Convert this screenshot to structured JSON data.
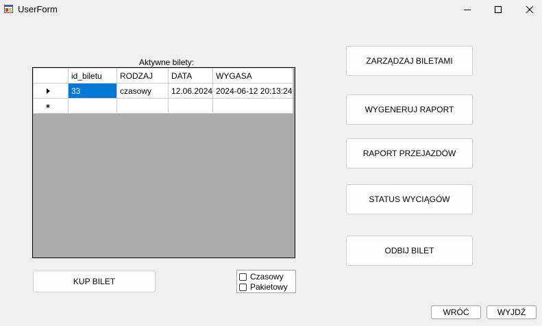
{
  "window": {
    "title": "UserForm",
    "minimize_icon": "minimize-icon",
    "maximize_icon": "maximize-icon",
    "close_icon": "close-icon"
  },
  "grid_caption": "Aktywne bilety:",
  "grid": {
    "columns": [
      "id_biletu",
      "RODZAJ",
      "DATA",
      "WYGASA"
    ],
    "rows": [
      {
        "indicator": "current-row-arrow-icon",
        "cells": [
          "33",
          "czasowy",
          "12.06.2024",
          "2024-06-12 20:13:24"
        ]
      },
      {
        "indicator": "new-row-asterisk-icon",
        "cells": [
          "",
          "",
          "",
          ""
        ]
      }
    ],
    "selected_cell": "33"
  },
  "buttons": {
    "manage_tickets": "ZARZĄDZAJ BILETAMI",
    "generate_report": "WYGENERUJ RAPORT",
    "rides_report": "RAPORT PRZEJAZDÓW",
    "lifts_status": "STATUS WYCIĄGÓW",
    "stamp_ticket": "ODBIJ BILET",
    "buy_ticket": "KUP BILET",
    "back": "WRÓĆ",
    "exit": "WYJDŹ"
  },
  "filters": {
    "time": {
      "label": "Czasowy",
      "checked": false
    },
    "package": {
      "label": "Pakietowy",
      "checked": false
    }
  },
  "colors": {
    "selection": "#0078d7",
    "grid_background": "#ababab",
    "form_background": "#f0f0f0"
  }
}
